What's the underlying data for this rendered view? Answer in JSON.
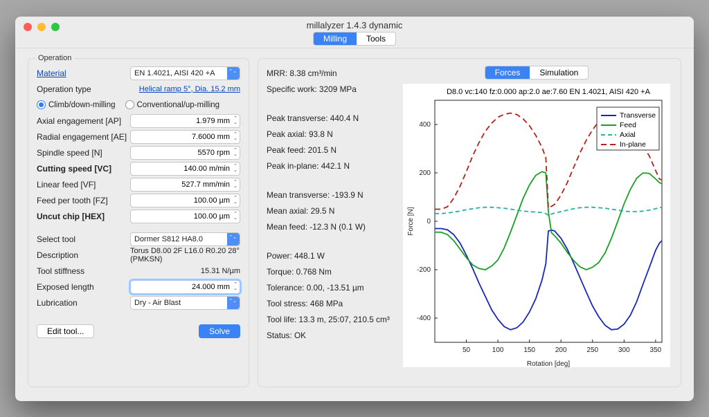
{
  "window_title": "millalyzer 1.4.3 dynamic",
  "top_tabs": {
    "milling": "Milling",
    "tools": "Tools",
    "active": "milling"
  },
  "operation_legend": "Operation",
  "material_label": "Material",
  "material_value": "EN 1.4021, AISI 420 +A",
  "optype_label": "Operation type",
  "optype_link": "Helical ramp 5°, Dia. 15.2 mm",
  "radio_climb": "Climb/down-milling",
  "radio_conv": "Conventional/up-milling",
  "fields": {
    "ap": {
      "label": "Axial engagement [AP]",
      "value": "1.979 mm"
    },
    "ae": {
      "label": "Radial engagement [AE]",
      "value": "7.6000 mm"
    },
    "n": {
      "label": "Spindle speed [N]",
      "value": "5570 rpm"
    },
    "vc": {
      "label": "Cutting speed [VC]",
      "value": "140.00 m/min",
      "bold": true
    },
    "vf": {
      "label": "Linear feed [VF]",
      "value": "527.7 mm/min"
    },
    "fz": {
      "label": "Feed per tooth [FZ]",
      "value": "100.00 µm"
    },
    "hex": {
      "label": "Uncut chip [HEX]",
      "value": "100.00 µm",
      "bold": true
    }
  },
  "tool": {
    "select_label": "Select tool",
    "select_value": "Dormer S812 HA8.0",
    "desc_label": "Description",
    "desc_value": "Torus D8.00 2F L16.0 R0.20 28° (PMKSN)",
    "stiff_label": "Tool stiffness",
    "stiff_value": "15.31 N/µm",
    "exposed_label": "Exposed length",
    "exposed_value": "24.000 mm",
    "lube_label": "Lubrication",
    "lube_value": "Dry - Air Blast"
  },
  "buttons": {
    "edit": "Edit tool...",
    "solve": "Solve"
  },
  "results": {
    "mrr": "MRR: 8.38 cm³/min",
    "spec": "Specific work: 3209 MPa",
    "peak_tr": "Peak transverse: 440.4 N",
    "peak_ax": "Peak axial: 93.8 N",
    "peak_fd": "Peak feed: 201.5 N",
    "peak_ip": "Peak in-plane: 442.1 N",
    "mean_tr": "Mean transverse: -193.9 N",
    "mean_ax": "Mean axial: 29.5 N",
    "mean_fd": "Mean feed: -12.3 N (0.1 W)",
    "power": "Power: 448.1 W",
    "torque": "Torque: 0.768 Nm",
    "tol": "Tolerance: 0.00, -13.51 µm",
    "stress": "Tool stress: 468 MPa",
    "life": "Tool life: 13.3 m, 25:07, 210.5 cm³",
    "status": "Status: OK"
  },
  "right_tabs": {
    "forces": "Forces",
    "sim": "Simulation",
    "active": "forces"
  },
  "chart_data": {
    "type": "line",
    "title": "D8.0 vc:140 fz:0.000 ap:2.0 ae:7.60 EN 1.4021, AISI 420 +A",
    "xlabel": "Rotation [deg]",
    "ylabel": "Force [N]",
    "xlim": [
      0,
      360
    ],
    "ylim": [
      -500,
      500
    ],
    "xticks": [
      50,
      100,
      150,
      200,
      250,
      300,
      350
    ],
    "yticks": [
      -400,
      -200,
      0,
      200,
      400
    ],
    "legend": [
      "Transverse",
      "Feed",
      "Axial",
      "In-plane"
    ],
    "x": [
      0,
      10,
      20,
      30,
      40,
      50,
      60,
      70,
      80,
      90,
      100,
      110,
      120,
      130,
      140,
      150,
      160,
      170,
      176,
      180,
      185,
      190,
      200,
      210,
      220,
      230,
      240,
      250,
      260,
      270,
      280,
      290,
      300,
      310,
      320,
      330,
      340,
      350,
      356,
      360
    ],
    "series": [
      {
        "name": "Transverse",
        "color": "#1626b5",
        "dash": "",
        "y": [
          -30,
          -30,
          -35,
          -55,
          -90,
          -140,
          -195,
          -255,
          -310,
          -365,
          -405,
          -435,
          -448,
          -440,
          -416,
          -375,
          -320,
          -242,
          -175,
          -40,
          -36,
          -40,
          -70,
          -115,
          -172,
          -232,
          -292,
          -350,
          -395,
          -430,
          -448,
          -445,
          -425,
          -388,
          -332,
          -260,
          -191,
          -120,
          -90,
          -80
        ]
      },
      {
        "name": "Feed",
        "color": "#17a123",
        "dash": "",
        "y": [
          -45,
          -45,
          -55,
          -80,
          -115,
          -150,
          -180,
          -195,
          -200,
          -185,
          -160,
          -110,
          -45,
          25,
          95,
          150,
          190,
          205,
          200,
          40,
          -48,
          -60,
          -90,
          -128,
          -162,
          -188,
          -200,
          -190,
          -170,
          -130,
          -70,
          0,
          72,
          132,
          178,
          200,
          198,
          175,
          160,
          155
        ]
      },
      {
        "name": "Axial",
        "color": "#23b0a6",
        "dash": "6 4",
        "y": [
          32,
          32,
          34,
          38,
          42,
          48,
          52,
          56,
          58,
          58,
          56,
          54,
          50,
          46,
          42,
          40,
          38,
          36,
          32,
          24,
          30,
          34,
          40,
          46,
          52,
          56,
          58,
          58,
          56,
          54,
          50,
          46,
          42,
          40,
          40,
          42,
          46,
          52,
          56,
          58
        ]
      },
      {
        "name": "In-plane",
        "color": "#b22218",
        "dash": "8 5",
        "y": [
          50,
          50,
          60,
          95,
          145,
          205,
          270,
          325,
          372,
          405,
          430,
          442,
          447,
          441,
          423,
          395,
          355,
          305,
          262,
          54,
          62,
          70,
          108,
          160,
          222,
          282,
          334,
          378,
          412,
          436,
          446,
          444,
          428,
          400,
          360,
          310,
          270,
          210,
          175,
          170
        ]
      }
    ]
  }
}
